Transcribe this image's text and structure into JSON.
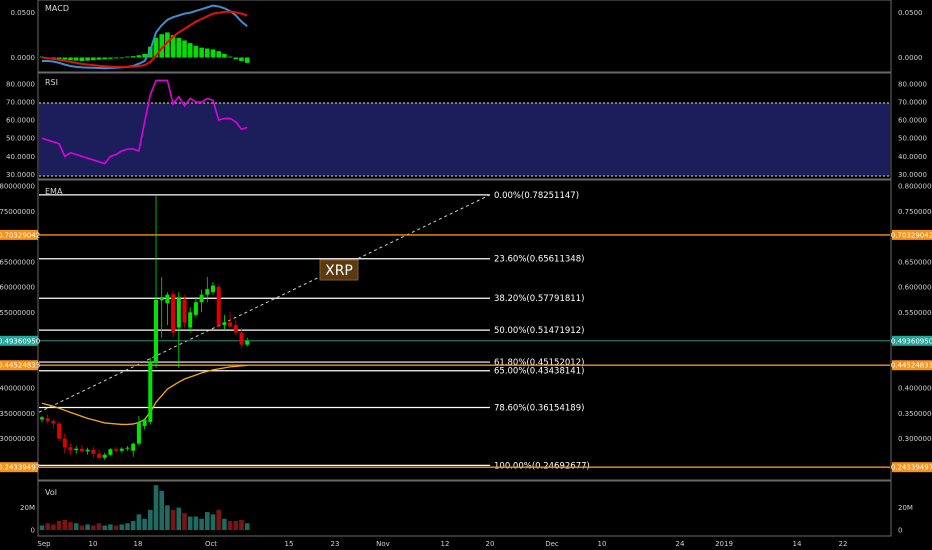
{
  "panes": {
    "macd": {
      "label": "MACD",
      "ticks": [
        {
          "v": 0.05,
          "t": "0.0500"
        },
        {
          "v": 0,
          "t": "0.0000"
        }
      ]
    },
    "rsi": {
      "label": "RSI",
      "ticks": [
        {
          "v": 80,
          "t": "80.0000"
        },
        {
          "v": 70,
          "t": "70.0000"
        },
        {
          "v": 60,
          "t": "60.0000"
        },
        {
          "v": 50,
          "t": "50.0000"
        },
        {
          "v": 40,
          "t": "40.0000"
        },
        {
          "v": 30,
          "t": "30.0000"
        }
      ]
    },
    "price": {
      "label": "EMA",
      "ticks": [
        {
          "v": 0.8,
          "t": "0.80000000"
        },
        {
          "v": 0.75,
          "t": "0.75000000"
        },
        {
          "v": 0.65,
          "t": "0.65000000"
        },
        {
          "v": 0.6,
          "t": "0.60000000"
        },
        {
          "v": 0.55,
          "t": "0.55000000"
        },
        {
          "v": 0.4,
          "t": "0.40000000"
        },
        {
          "v": 0.35,
          "t": "0.35000000"
        },
        {
          "v": 0.3,
          "t": "0.30000000"
        }
      ]
    },
    "vol": {
      "label": "Vol",
      "ticks": [
        {
          "v": 20,
          "t": "20M"
        },
        {
          "v": 0,
          "t": "0"
        }
      ]
    }
  },
  "x_ticks": [
    "Sep",
    "10",
    "18",
    "Oct",
    "15",
    "23",
    "Nov",
    "12",
    "20",
    "Dec",
    "10",
    "24",
    "2019",
    "14",
    "22"
  ],
  "price_boxes": [
    {
      "label": "0.70329042",
      "value": 0.70329042,
      "color": "#f7931a"
    },
    {
      "label": "0.49360950",
      "value": 0.4936095,
      "color": "#26a69a"
    },
    {
      "label": "0.44524833",
      "value": 0.44524833,
      "color": "#f7931a"
    },
    {
      "label": "0.24339497",
      "value": 0.24339497,
      "color": "#f7931a"
    }
  ],
  "fib_levels": [
    {
      "label": "0.00%(0.78251147)",
      "value": 0.78251147
    },
    {
      "label": "23.60%(0.65611348)",
      "value": 0.65611348
    },
    {
      "label": "38.20%(0.57791811)",
      "value": 0.57791811
    },
    {
      "label": "50.00%(0.51471912)",
      "value": 0.51471912
    },
    {
      "label": "61.80%(0.45152012)",
      "value": 0.45152012
    },
    {
      "label": "65.00%(0.43438141)",
      "value": 0.43438141
    },
    {
      "label": "78.60%(0.36154189)",
      "value": 0.36154189
    },
    {
      "label": "100.00%(0.24692677)",
      "value": 0.24692677
    }
  ],
  "annotation": {
    "text": "XRP"
  },
  "colors": {
    "bull": "#00e600",
    "bear": "#e00000",
    "macd": "#3a8fd0",
    "signal": "#e01010",
    "rsi": "#e000e0",
    "ema": "#f7a71a",
    "fib": "#ffffff",
    "orange": "#f7931a"
  },
  "chart_data": {
    "type": "candlestick",
    "ylim": [
      0.22,
      0.81
    ],
    "candles": [
      {
        "o": 0.338,
        "h": 0.345,
        "l": 0.332,
        "c": 0.342
      },
      {
        "o": 0.34,
        "h": 0.348,
        "l": 0.33,
        "c": 0.335
      },
      {
        "o": 0.335,
        "h": 0.338,
        "l": 0.32,
        "c": 0.33
      },
      {
        "o": 0.33,
        "h": 0.335,
        "l": 0.295,
        "c": 0.3
      },
      {
        "o": 0.3,
        "h": 0.31,
        "l": 0.27,
        "c": 0.283
      },
      {
        "o": 0.283,
        "h": 0.29,
        "l": 0.268,
        "c": 0.277
      },
      {
        "o": 0.277,
        "h": 0.285,
        "l": 0.27,
        "c": 0.28
      },
      {
        "o": 0.28,
        "h": 0.287,
        "l": 0.272,
        "c": 0.275
      },
      {
        "o": 0.275,
        "h": 0.282,
        "l": 0.268,
        "c": 0.278
      },
      {
        "o": 0.278,
        "h": 0.284,
        "l": 0.262,
        "c": 0.27
      },
      {
        "o": 0.27,
        "h": 0.279,
        "l": 0.258,
        "c": 0.262
      },
      {
        "o": 0.262,
        "h": 0.272,
        "l": 0.258,
        "c": 0.268
      },
      {
        "o": 0.268,
        "h": 0.281,
        "l": 0.265,
        "c": 0.279
      },
      {
        "o": 0.279,
        "h": 0.284,
        "l": 0.273,
        "c": 0.276
      },
      {
        "o": 0.276,
        "h": 0.283,
        "l": 0.272,
        "c": 0.28
      },
      {
        "o": 0.28,
        "h": 0.285,
        "l": 0.276,
        "c": 0.282
      },
      {
        "o": 0.276,
        "h": 0.292,
        "l": 0.264,
        "c": 0.29
      },
      {
        "o": 0.29,
        "h": 0.345,
        "l": 0.285,
        "c": 0.332
      },
      {
        "o": 0.325,
        "h": 0.34,
        "l": 0.318,
        "c": 0.338
      },
      {
        "o": 0.333,
        "h": 0.46,
        "l": 0.328,
        "c": 0.452
      },
      {
        "o": 0.45,
        "h": 0.78,
        "l": 0.44,
        "c": 0.575
      },
      {
        "o": 0.574,
        "h": 0.62,
        "l": 0.5,
        "c": 0.58
      },
      {
        "o": 0.568,
        "h": 0.59,
        "l": 0.525,
        "c": 0.585
      },
      {
        "o": 0.586,
        "h": 0.592,
        "l": 0.5,
        "c": 0.51
      },
      {
        "o": 0.52,
        "h": 0.59,
        "l": 0.44,
        "c": 0.58
      },
      {
        "o": 0.575,
        "h": 0.585,
        "l": 0.52,
        "c": 0.53
      },
      {
        "o": 0.52,
        "h": 0.56,
        "l": 0.51,
        "c": 0.55
      },
      {
        "o": 0.545,
        "h": 0.58,
        "l": 0.54,
        "c": 0.57
      },
      {
        "o": 0.57,
        "h": 0.595,
        "l": 0.55,
        "c": 0.585
      },
      {
        "o": 0.585,
        "h": 0.62,
        "l": 0.57,
        "c": 0.596
      },
      {
        "o": 0.59,
        "h": 0.61,
        "l": 0.585,
        "c": 0.603
      },
      {
        "o": 0.6,
        "h": 0.605,
        "l": 0.52,
        "c": 0.525
      },
      {
        "o": 0.525,
        "h": 0.545,
        "l": 0.515,
        "c": 0.53
      },
      {
        "o": 0.53,
        "h": 0.55,
        "l": 0.52,
        "c": 0.522
      },
      {
        "o": 0.525,
        "h": 0.535,
        "l": 0.505,
        "c": 0.51
      },
      {
        "o": 0.51,
        "h": 0.52,
        "l": 0.48,
        "c": 0.486
      },
      {
        "o": 0.486,
        "h": 0.5,
        "l": 0.482,
        "c": 0.494
      }
    ],
    "ema": [
      0.37,
      0.367,
      0.364,
      0.36,
      0.356,
      0.352,
      0.348,
      0.344,
      0.34,
      0.337,
      0.334,
      0.331,
      0.33,
      0.329,
      0.328,
      0.328,
      0.329,
      0.332,
      0.338,
      0.352,
      0.372,
      0.385,
      0.398,
      0.405,
      0.412,
      0.418,
      0.422,
      0.426,
      0.43,
      0.433,
      0.436,
      0.438,
      0.44,
      0.442,
      0.443,
      0.444,
      0.445
    ],
    "macd": {
      "ylim": [
        -0.014,
        0.062
      ],
      "macd": [
        -0.004,
        -0.004,
        -0.0045,
        -0.006,
        -0.008,
        -0.0095,
        -0.0105,
        -0.011,
        -0.0113,
        -0.0115,
        -0.0118,
        -0.012,
        -0.0118,
        -0.0115,
        -0.011,
        -0.0105,
        -0.0095,
        -0.007,
        -0.004,
        0.008,
        0.028,
        0.036,
        0.042,
        0.045,
        0.047,
        0.049,
        0.05,
        0.052,
        0.054,
        0.056,
        0.058,
        0.057,
        0.055,
        0.052,
        0.047,
        0.04,
        0.035
      ],
      "signal": [
        0.0,
        -0.0008,
        -0.0016,
        -0.0025,
        -0.0036,
        -0.0048,
        -0.006,
        -0.0071,
        -0.0079,
        -0.0086,
        -0.0093,
        -0.0098,
        -0.0102,
        -0.0104,
        -0.0105,
        -0.0105,
        -0.0103,
        -0.0097,
        -0.0085,
        -0.005,
        0.002,
        0.01,
        0.017,
        0.023,
        0.028,
        0.032,
        0.036,
        0.04,
        0.043,
        0.046,
        0.049,
        0.05,
        0.051,
        0.0512,
        0.0505,
        0.049,
        0.047
      ],
      "hist": [
        0.001,
        -0.001,
        -0.0015,
        -0.002,
        -0.0025,
        -0.003,
        -0.0035,
        -0.004,
        -0.0035,
        -0.003,
        -0.0025,
        -0.002,
        -0.0015,
        -0.001,
        -0.0005,
        0.001,
        0.0015,
        0.0025,
        0.004,
        0.012,
        0.022,
        0.026,
        0.028,
        0.025,
        0.022,
        0.019,
        0.016,
        0.013,
        0.011,
        0.01,
        0.009,
        0.007,
        0.004,
        0.001,
        -0.002,
        -0.004,
        -0.006
      ]
    },
    "rsi": {
      "ylim": [
        28,
        85
      ],
      "values": [
        50,
        49,
        48,
        47,
        40,
        42,
        41,
        40,
        39,
        38,
        37,
        36,
        40,
        41,
        43,
        44,
        44,
        43,
        59,
        74,
        82,
        82,
        82,
        69,
        73,
        68,
        72,
        70,
        70,
        72,
        71,
        60,
        61,
        61,
        59,
        55,
        56
      ]
    },
    "volume": {
      "ylim": [
        0,
        42
      ],
      "values": [
        4,
        6,
        5,
        8,
        9,
        7,
        6,
        4,
        5,
        4,
        6,
        4,
        5,
        4,
        5,
        6,
        8,
        14,
        10,
        18,
        40,
        35,
        22,
        18,
        20,
        15,
        12,
        12,
        10,
        16,
        14,
        18,
        10,
        8,
        8,
        9,
        6
      ]
    }
  }
}
